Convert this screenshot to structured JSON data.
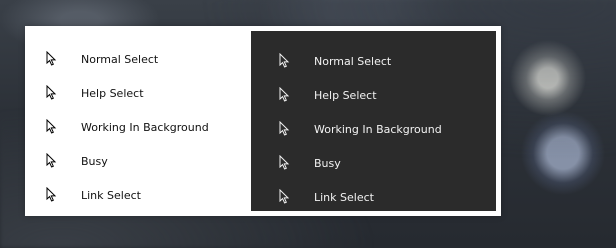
{
  "cursors": {
    "light_theme": [
      {
        "label": "Normal Select",
        "icon": "arrow-pointer-icon"
      },
      {
        "label": "Help Select",
        "icon": "arrow-pointer-icon"
      },
      {
        "label": "Working In Background",
        "icon": "arrow-pointer-icon"
      },
      {
        "label": "Busy",
        "icon": "arrow-pointer-icon"
      },
      {
        "label": "Link Select",
        "icon": "arrow-pointer-icon"
      }
    ],
    "dark_theme": [
      {
        "label": "Normal Select",
        "icon": "arrow-pointer-icon"
      },
      {
        "label": "Help Select",
        "icon": "arrow-pointer-icon"
      },
      {
        "label": "Working In Background",
        "icon": "arrow-pointer-icon"
      },
      {
        "label": "Busy",
        "icon": "arrow-pointer-icon"
      },
      {
        "label": "Link Select",
        "icon": "arrow-pointer-icon"
      }
    ]
  },
  "colors": {
    "light_panel_bg": "#ffffff",
    "dark_panel_bg": "#2b2b2b",
    "light_text": "#111111",
    "dark_text": "#f2f2f2"
  }
}
